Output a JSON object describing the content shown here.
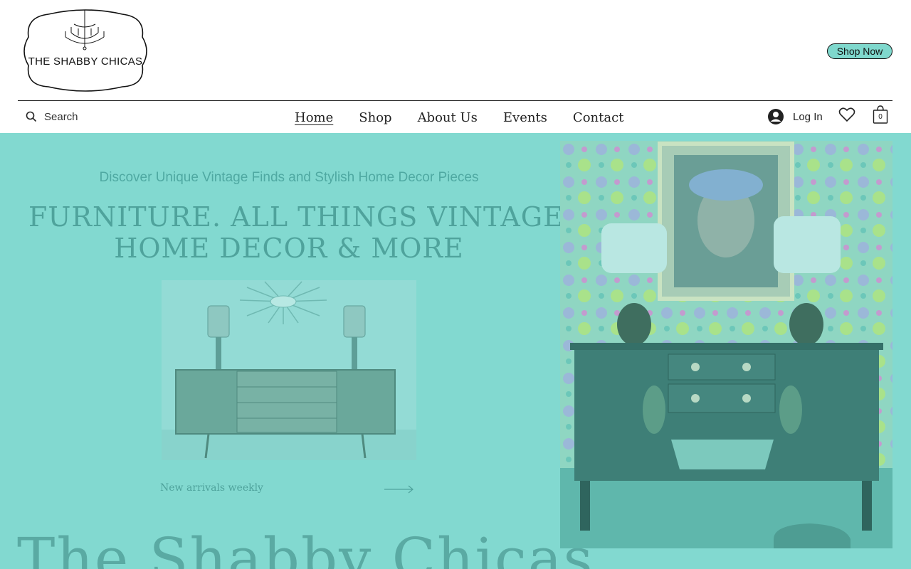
{
  "brand": {
    "name": "THE SHABBY CHICAS"
  },
  "header": {
    "shop_now_label": "Shop Now"
  },
  "search": {
    "label": "Search"
  },
  "nav": {
    "items": [
      {
        "label": "Home",
        "active": true
      },
      {
        "label": "Shop",
        "active": false
      },
      {
        "label": "About Us",
        "active": false
      },
      {
        "label": "Events",
        "active": false
      },
      {
        "label": "Contact",
        "active": false
      }
    ]
  },
  "account": {
    "login_label": "Log In",
    "cart_count": "0"
  },
  "hero": {
    "subtitle": "Discover Unique Vintage Finds and Stylish Home Decor Pieces",
    "headline_line1": "FURNITURE. ALL THINGS VINTAGE.",
    "headline_line2": "HOME DECOR & MORE",
    "arrivals_label": "New arrivals weekly",
    "big_title": "The Shabby Chicas"
  },
  "icons": [
    "search-icon",
    "user-icon",
    "heart-icon",
    "cart-icon",
    "arrow-right-icon",
    "chandelier-icon"
  ],
  "colors": {
    "accent": "#82d9d0",
    "button": "#7fd8cd",
    "hero_text": "#4fa39c"
  }
}
